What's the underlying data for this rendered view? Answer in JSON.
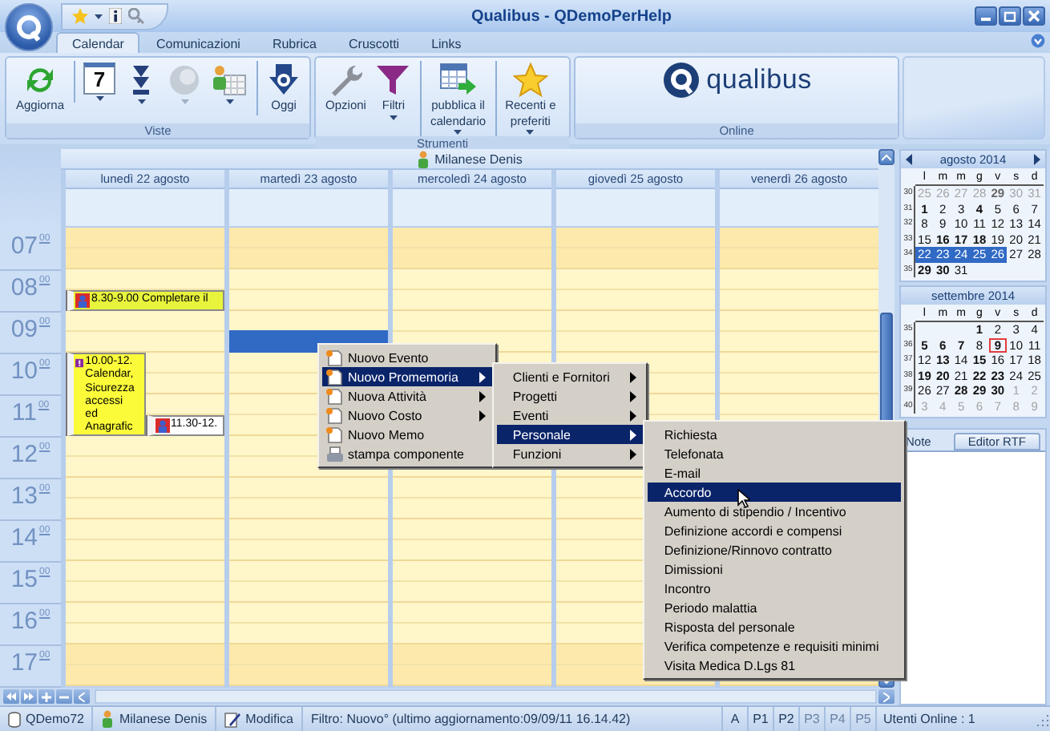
{
  "window": {
    "title": "Qualibus  -  QDemoPerHelp"
  },
  "tabs": [
    {
      "label": "Calendar",
      "selected": true
    },
    {
      "label": "Comunicazioni",
      "selected": false
    },
    {
      "label": "Rubrica",
      "selected": false
    },
    {
      "label": "Cruscotti",
      "selected": false
    },
    {
      "label": "Links",
      "selected": false
    }
  ],
  "ribbon": {
    "groups": [
      {
        "label": "Viste",
        "buttons": [
          {
            "kind": "refresh",
            "lines": [
              "Aggiorna"
            ],
            "dropdown": false,
            "disabled": false,
            "separator": false
          },
          {
            "kind": "calendar",
            "glyph": "7",
            "dropdown": true,
            "disabled": false,
            "separator": true
          },
          {
            "kind": "arrows",
            "dropdown": true,
            "disabled": false,
            "separator": false
          },
          {
            "kind": "circle",
            "dropdown": true,
            "disabled": true,
            "separator": false
          },
          {
            "kind": "people",
            "dropdown": true,
            "disabled": false,
            "separator": false
          },
          {
            "kind": "today",
            "lines": [
              "Oggi"
            ],
            "dropdown": false,
            "disabled": false,
            "separator": true
          }
        ]
      },
      {
        "label": "Strumenti",
        "buttons": [
          {
            "kind": "wrench",
            "lines": [
              "Opzioni"
            ],
            "dropdown": false,
            "disabled": false,
            "separator": false
          },
          {
            "kind": "filter",
            "lines": [
              "Filtri"
            ],
            "dropdown": true,
            "disabled": false,
            "separator": false
          },
          {
            "kind": "publish",
            "lines": [
              "pubblica il",
              "calendario"
            ],
            "dropdown": true,
            "disabled": false,
            "separator": true
          },
          {
            "kind": "star",
            "lines": [
              "Recenti e",
              "preferiti"
            ],
            "dropdown": true,
            "disabled": false,
            "separator": true
          }
        ]
      },
      {
        "label": "Online",
        "logo": "qualibus"
      }
    ]
  },
  "calendar": {
    "person": "Milanese Denis",
    "hours": [
      {
        "label": "07",
        "minutes": "00",
        "working": false,
        "selection_first_half": false,
        "selection_second_half": false
      },
      {
        "label": "08",
        "minutes": "00",
        "working": true,
        "selection_first_half": false,
        "selection_second_half": false
      },
      {
        "label": "09",
        "minutes": "00",
        "working": true,
        "selection_first_half": false,
        "selection_second_half": true
      },
      {
        "label": "10",
        "minutes": "00",
        "working": true,
        "selection_first_half": false,
        "selection_second_half": false
      },
      {
        "label": "11",
        "minutes": "00",
        "working": true,
        "selection_first_half": false,
        "selection_second_half": false
      },
      {
        "label": "12",
        "minutes": "00",
        "working": true,
        "selection_first_half": false,
        "selection_second_half": false
      },
      {
        "label": "13",
        "minutes": "00",
        "working": true,
        "selection_first_half": false,
        "selection_second_half": false
      },
      {
        "label": "14",
        "minutes": "00",
        "working": true,
        "selection_first_half": false,
        "selection_second_half": false
      },
      {
        "label": "15",
        "minutes": "00",
        "working": true,
        "selection_first_half": false,
        "selection_second_half": false
      },
      {
        "label": "16",
        "minutes": "00",
        "working": true,
        "selection_first_half": false,
        "selection_second_half": false
      },
      {
        "label": "17",
        "minutes": "00",
        "working": false,
        "selection_first_half": false,
        "selection_second_half": false
      }
    ],
    "days": [
      {
        "label": "lunedì 22 agosto",
        "events": [
          {
            "kind": "reminder",
            "time": "8.30-9.00",
            "lines": [
              "Completare il"
            ],
            "color": "#e8f43c"
          },
          {
            "kind": "alert",
            "time": "10.00-12.",
            "lines": [
              "Calendar,",
              "Sicurezza",
              "accessi",
              "ed",
              "Anagrafic"
            ],
            "color": "#fbfb3a"
          },
          {
            "kind": "reminder",
            "time": "11.30-12.",
            "color": "#ffffff"
          }
        ],
        "selected": false
      },
      {
        "label": "martedì 23 agosto",
        "selected": true
      },
      {
        "label": "mercoledì 24 agosto",
        "selected": false
      },
      {
        "label": "giovedì 25 agosto",
        "selected": false
      },
      {
        "label": "venerdì 26 agosto",
        "selected": false
      }
    ]
  },
  "context_menu": {
    "menus": [
      {
        "items": [
          {
            "label": "Nuovo Evento",
            "kind": "new",
            "submenu": false,
            "selected": false
          },
          {
            "label": "Nuovo Promemoria",
            "kind": "new",
            "submenu": true,
            "selected": true
          },
          {
            "label": "Nuova Attività",
            "kind": "new",
            "submenu": true,
            "selected": false
          },
          {
            "label": "Nuovo Costo",
            "kind": "new",
            "submenu": true,
            "selected": false
          },
          {
            "label": "Nuovo Memo",
            "kind": "new",
            "submenu": false,
            "selected": false
          },
          {
            "label": "stampa componente",
            "kind": "print",
            "submenu": false,
            "selected": false
          }
        ]
      },
      {
        "items": [
          {
            "label": "Clienti e Fornitori",
            "kind": "plain",
            "submenu": true,
            "selected": false
          },
          {
            "label": "Progetti",
            "kind": "plain",
            "submenu": true,
            "selected": false
          },
          {
            "label": "Eventi",
            "kind": "plain",
            "submenu": true,
            "selected": false
          },
          {
            "label": "Personale",
            "kind": "plain",
            "submenu": true,
            "selected": true
          },
          {
            "label": "Funzioni",
            "kind": "plain",
            "submenu": true,
            "selected": false
          }
        ]
      },
      {
        "items": [
          {
            "label": "Richiesta",
            "kind": "plain",
            "submenu": false,
            "selected": false
          },
          {
            "label": "Telefonata",
            "kind": "plain",
            "submenu": false,
            "selected": false
          },
          {
            "label": "E-mail",
            "kind": "plain",
            "submenu": false,
            "selected": false
          },
          {
            "label": "Accordo",
            "kind": "plain",
            "submenu": false,
            "selected": true
          },
          {
            "label": "Aumento di stipendio / Incentivo",
            "kind": "plain",
            "submenu": false,
            "selected": false
          },
          {
            "label": "Definizione accordi e compensi",
            "kind": "plain",
            "submenu": false,
            "selected": false
          },
          {
            "label": "Definizione/Rinnovo contratto",
            "kind": "plain",
            "submenu": false,
            "selected": false
          },
          {
            "label": "Dimissioni",
            "kind": "plain",
            "submenu": false,
            "selected": false
          },
          {
            "label": "Incontro",
            "kind": "plain",
            "submenu": false,
            "selected": false
          },
          {
            "label": "Periodo malattia",
            "kind": "plain",
            "submenu": false,
            "selected": false
          },
          {
            "label": "Risposta del personale",
            "kind": "plain",
            "submenu": false,
            "selected": false
          },
          {
            "label": "Verifica competenze e requisiti minimi",
            "kind": "plain",
            "submenu": false,
            "selected": false
          },
          {
            "label": "Visita Medica D.Lgs 81",
            "kind": "plain",
            "submenu": false,
            "selected": false
          }
        ]
      }
    ]
  },
  "mini_calendars": [
    {
      "title": "agosto 2014",
      "arrows": true,
      "weekdays": [
        "l",
        "m",
        "m",
        "g",
        "v",
        "s",
        "d"
      ],
      "weeks": [
        {
          "number": "30",
          "days": [
            {
              "day": "25",
              "muted": true,
              "bold": false,
              "selected": false,
              "today": false
            },
            {
              "day": "26",
              "muted": true,
              "bold": false,
              "selected": false,
              "today": false
            },
            {
              "day": "27",
              "muted": true,
              "bold": false,
              "selected": false,
              "today": false
            },
            {
              "day": "28",
              "muted": true,
              "bold": false,
              "selected": false,
              "today": false
            },
            {
              "day": "29",
              "muted": true,
              "bold": true,
              "selected": false,
              "today": false
            },
            {
              "day": "30",
              "muted": true,
              "bold": false,
              "selected": false,
              "today": false
            },
            {
              "day": "31",
              "muted": true,
              "bold": false,
              "selected": false,
              "today": false
            }
          ]
        },
        {
          "number": "31",
          "days": [
            {
              "day": "1",
              "muted": false,
              "bold": true,
              "selected": false,
              "today": false
            },
            {
              "day": "2",
              "muted": false,
              "bold": false,
              "selected": false,
              "today": false
            },
            {
              "day": "3",
              "muted": false,
              "bold": false,
              "selected": false,
              "today": false
            },
            {
              "day": "4",
              "muted": false,
              "bold": true,
              "selected": false,
              "today": false
            },
            {
              "day": "5",
              "muted": false,
              "bold": false,
              "selected": false,
              "today": false
            },
            {
              "day": "6",
              "muted": false,
              "bold": false,
              "selected": false,
              "today": false
            },
            {
              "day": "7",
              "muted": false,
              "bold": false,
              "selected": false,
              "today": false
            }
          ]
        },
        {
          "number": "32",
          "days": [
            {
              "day": "8",
              "muted": false,
              "bold": false,
              "selected": false,
              "today": false
            },
            {
              "day": "9",
              "muted": false,
              "bold": false,
              "selected": false,
              "today": false
            },
            {
              "day": "10",
              "muted": false,
              "bold": false,
              "selected": false,
              "today": false
            },
            {
              "day": "11",
              "muted": false,
              "bold": false,
              "selected": false,
              "today": false
            },
            {
              "day": "12",
              "muted": false,
              "bold": false,
              "selected": false,
              "today": false
            },
            {
              "day": "13",
              "muted": false,
              "bold": false,
              "selected": false,
              "today": false
            },
            {
              "day": "14",
              "muted": false,
              "bold": false,
              "selected": false,
              "today": false
            }
          ]
        },
        {
          "number": "33",
          "days": [
            {
              "day": "15",
              "muted": false,
              "bold": false,
              "selected": false,
              "today": false
            },
            {
              "day": "16",
              "muted": false,
              "bold": true,
              "selected": false,
              "today": false
            },
            {
              "day": "17",
              "muted": false,
              "bold": true,
              "selected": false,
              "today": false
            },
            {
              "day": "18",
              "muted": false,
              "bold": true,
              "selected": false,
              "today": false
            },
            {
              "day": "19",
              "muted": false,
              "bold": false,
              "selected": false,
              "today": false
            },
            {
              "day": "20",
              "muted": false,
              "bold": false,
              "selected": false,
              "today": false
            },
            {
              "day": "21",
              "muted": false,
              "bold": false,
              "selected": false,
              "today": false
            }
          ]
        },
        {
          "number": "34",
          "days": [
            {
              "day": "22",
              "muted": false,
              "bold": false,
              "selected": true,
              "today": false
            },
            {
              "day": "23",
              "muted": false,
              "bold": false,
              "selected": true,
              "today": false
            },
            {
              "day": "24",
              "muted": false,
              "bold": false,
              "selected": true,
              "today": false
            },
            {
              "day": "25",
              "muted": false,
              "bold": false,
              "selected": true,
              "today": false
            },
            {
              "day": "26",
              "muted": false,
              "bold": false,
              "selected": true,
              "today": false
            },
            {
              "day": "27",
              "muted": false,
              "bold": false,
              "selected": false,
              "today": false
            },
            {
              "day": "28",
              "muted": false,
              "bold": false,
              "selected": false,
              "today": false
            }
          ]
        },
        {
          "number": "35",
          "days": [
            {
              "day": "29",
              "muted": false,
              "bold": true,
              "selected": false,
              "today": false
            },
            {
              "day": "30",
              "muted": false,
              "bold": true,
              "selected": false,
              "today": false
            },
            {
              "day": "31",
              "muted": false,
              "bold": false,
              "selected": false,
              "today": false
            }
          ]
        }
      ]
    },
    {
      "title": "settembre 2014",
      "arrows": false,
      "weekdays": [
        "l",
        "m",
        "m",
        "g",
        "v",
        "s",
        "d"
      ],
      "weeks": [
        {
          "number": "35",
          "days": [
            {
              "day": "1",
              "muted": false,
              "bold": true,
              "selected": false,
              "today": false
            },
            {
              "day": "2",
              "muted": false,
              "bold": false,
              "selected": false,
              "today": false
            },
            {
              "day": "3",
              "muted": false,
              "bold": false,
              "selected": false,
              "today": false
            },
            {
              "day": "4",
              "muted": false,
              "bold": false,
              "selected": false,
              "today": false
            }
          ]
        },
        {
          "number": "36",
          "days": [
            {
              "day": "5",
              "muted": false,
              "bold": true,
              "selected": false,
              "today": false
            },
            {
              "day": "6",
              "muted": false,
              "bold": true,
              "selected": false,
              "today": false
            },
            {
              "day": "7",
              "muted": false,
              "bold": true,
              "selected": false,
              "today": false
            },
            {
              "day": "8",
              "muted": false,
              "bold": false,
              "selected": false,
              "today": false
            },
            {
              "day": "9",
              "muted": false,
              "bold": true,
              "selected": false,
              "today": true
            },
            {
              "day": "10",
              "muted": false,
              "bold": false,
              "selected": false,
              "today": false
            },
            {
              "day": "11",
              "muted": false,
              "bold": false,
              "selected": false,
              "today": false
            }
          ]
        },
        {
          "number": "37",
          "days": [
            {
              "day": "12",
              "muted": false,
              "bold": false,
              "selected": false,
              "today": false
            },
            {
              "day": "13",
              "muted": false,
              "bold": true,
              "selected": false,
              "today": false
            },
            {
              "day": "14",
              "muted": false,
              "bold": false,
              "selected": false,
              "today": false
            },
            {
              "day": "15",
              "muted": false,
              "bold": true,
              "selected": false,
              "today": false
            },
            {
              "day": "16",
              "muted": false,
              "bold": false,
              "selected": false,
              "today": false
            },
            {
              "day": "17",
              "muted": false,
              "bold": false,
              "selected": false,
              "today": false
            },
            {
              "day": "18",
              "muted": false,
              "bold": false,
              "selected": false,
              "today": false
            }
          ]
        },
        {
          "number": "38",
          "days": [
            {
              "day": "19",
              "muted": false,
              "bold": true,
              "selected": false,
              "today": false
            },
            {
              "day": "20",
              "muted": false,
              "bold": true,
              "selected": false,
              "today": false
            },
            {
              "day": "21",
              "muted": false,
              "bold": false,
              "selected": false,
              "today": false
            },
            {
              "day": "22",
              "muted": false,
              "bold": true,
              "selected": false,
              "today": false
            },
            {
              "day": "23",
              "muted": false,
              "bold": true,
              "selected": false,
              "today": false
            },
            {
              "day": "24",
              "muted": false,
              "bold": false,
              "selected": false,
              "today": false
            },
            {
              "day": "25",
              "muted": false,
              "bold": false,
              "selected": false,
              "today": false
            }
          ]
        },
        {
          "number": "39",
          "days": [
            {
              "day": "26",
              "muted": false,
              "bold": false,
              "selected": false,
              "today": false
            },
            {
              "day": "27",
              "muted": false,
              "bold": false,
              "selected": false,
              "today": false
            },
            {
              "day": "28",
              "muted": false,
              "bold": true,
              "selected": false,
              "today": false
            },
            {
              "day": "29",
              "muted": false,
              "bold": true,
              "selected": false,
              "today": false
            },
            {
              "day": "30",
              "muted": false,
              "bold": true,
              "selected": false,
              "today": false
            },
            {
              "day": "1",
              "muted": true,
              "bold": false,
              "selected": false,
              "today": false
            },
            {
              "day": "2",
              "muted": true,
              "bold": false,
              "selected": false,
              "today": false
            }
          ]
        },
        {
          "number": "40",
          "days": [
            {
              "day": "3",
              "muted": true,
              "bold": false,
              "selected": false,
              "today": false
            },
            {
              "day": "4",
              "muted": true,
              "bold": false,
              "selected": false,
              "today": false
            },
            {
              "day": "5",
              "muted": true,
              "bold": false,
              "selected": false,
              "today": false
            },
            {
              "day": "6",
              "muted": true,
              "bold": false,
              "selected": false,
              "today": false
            },
            {
              "day": "7",
              "muted": true,
              "bold": false,
              "selected": false,
              "today": false
            },
            {
              "day": "8",
              "muted": true,
              "bold": false,
              "selected": false,
              "today": false
            },
            {
              "day": "9",
              "muted": true,
              "bold": false,
              "selected": false,
              "today": false
            }
          ]
        }
      ]
    }
  ],
  "note": {
    "label": "Note",
    "button": "Editor RTF"
  },
  "status_bar": {
    "fields": [
      {
        "kind": "database",
        "text": "QDemo72"
      },
      {
        "kind": "person",
        "text": "Milanese Denis"
      },
      {
        "kind": "edit",
        "text": "Modifica"
      },
      {
        "kind": "filter",
        "text": "Filtro: Nuovo° (ultimo aggiornamento:09/09/11 16.14.42)"
      }
    ],
    "priorities": [
      {
        "label": "A",
        "disabled": false
      },
      {
        "label": "P1",
        "disabled": false
      },
      {
        "label": "P2",
        "disabled": false
      },
      {
        "label": "P3",
        "disabled": true
      },
      {
        "label": "P4",
        "disabled": true
      },
      {
        "label": "P5",
        "disabled": true
      }
    ],
    "online": "Utenti Online : 1"
  }
}
